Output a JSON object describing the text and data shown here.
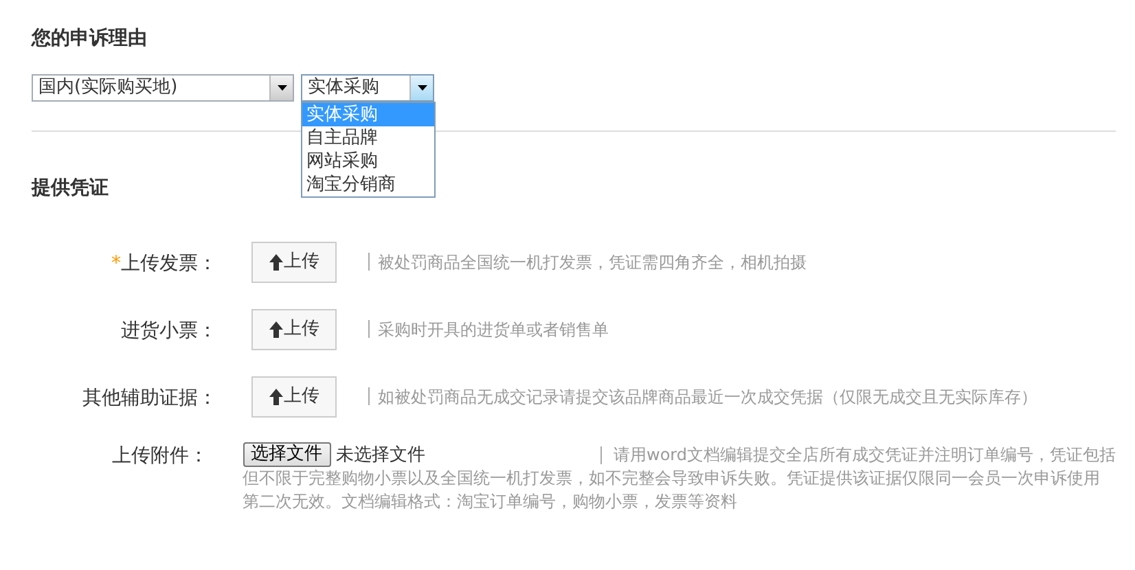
{
  "reason": {
    "title": "您的申诉理由",
    "region_select": {
      "value": "国内(实际购买地)"
    },
    "type_select": {
      "value": "实体采购",
      "expanded": true,
      "options": [
        {
          "label": "实体采购",
          "selected": true
        },
        {
          "label": "自主品牌",
          "selected": false
        },
        {
          "label": "网站采购",
          "selected": false
        },
        {
          "label": "淘宝分销商",
          "selected": false
        }
      ]
    }
  },
  "evidence": {
    "title": "提供凭证",
    "rows": [
      {
        "kind": "upload",
        "required_mark": "*",
        "label": "上传发票：",
        "button": "上传",
        "hint": "被处罚商品全国统一机打发票，凭证需四角齐全，相机拍摄"
      },
      {
        "kind": "upload",
        "label": "进货小票：",
        "button": "上传",
        "hint": "采购时开具的进货单或者销售单"
      },
      {
        "kind": "upload",
        "label": "其他辅助证据：",
        "button": "上传",
        "hint": "如被处罚商品无成交记录请提交该品牌商品最近一次成交凭据（仅限无成交且无实际库存）"
      },
      {
        "kind": "file",
        "label": "上传附件：",
        "button": "选择文件",
        "file_status": "未选择文件",
        "hint_lines": [
          "请用word文档编辑提交全店所有成交凭证并注明订单编号，凭证包括",
          "但不限于完整购物小票以及全国统一机打发票，如不完整会导致申诉失败。凭证提供该证据仅限同一会员一次申诉使用",
          "第二次无效。文档编辑格式：淘宝订单编号，购物小票，发票等资料"
        ]
      }
    ]
  }
}
